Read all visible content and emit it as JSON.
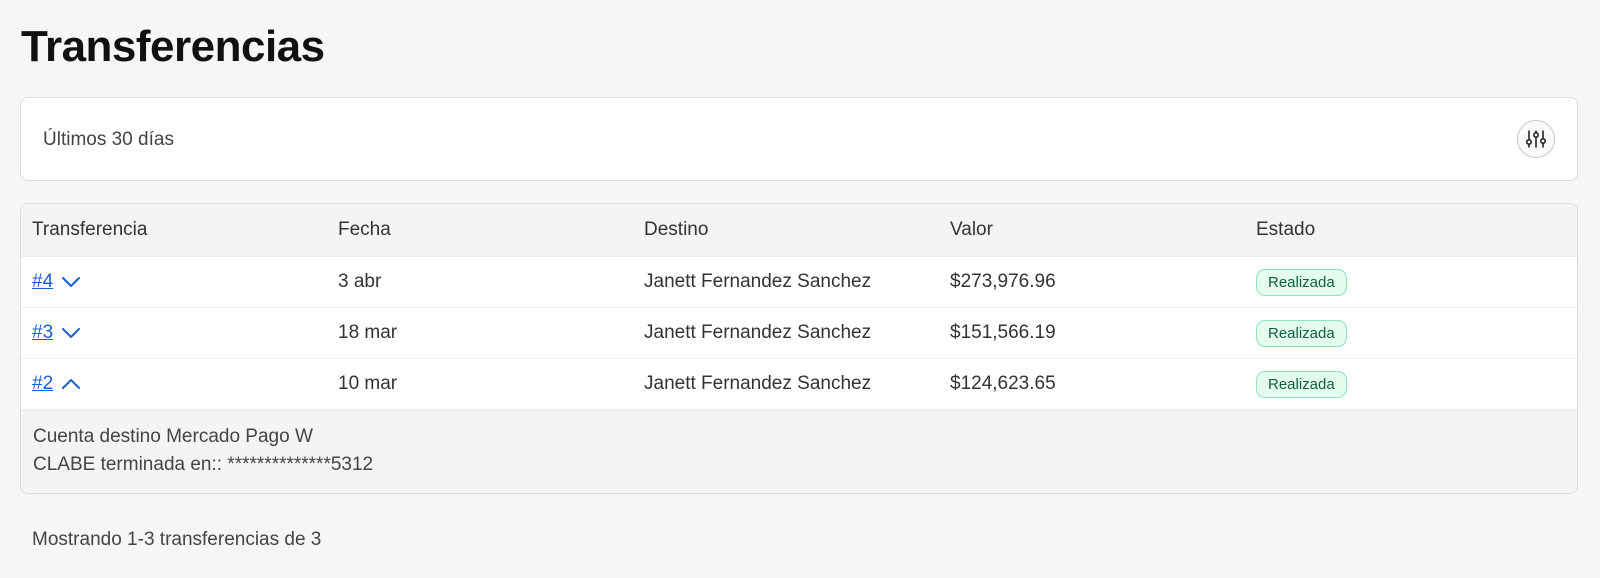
{
  "page": {
    "title": "Transferencias"
  },
  "filter": {
    "label": "Últimos 30 días",
    "button_icon": "sliders-icon"
  },
  "table": {
    "columns": [
      "Transferencia",
      "Fecha",
      "Destino",
      "Valor",
      "Estado"
    ],
    "rows": [
      {
        "id": "#4",
        "date": "3 abr",
        "destination": "Janett Fernandez Sanchez",
        "amount": "$273,976.96",
        "status": "Realizada",
        "expanded": false
      },
      {
        "id": "#3",
        "date": "18 mar",
        "destination": "Janett Fernandez Sanchez",
        "amount": "$151,566.19",
        "status": "Realizada",
        "expanded": false
      },
      {
        "id": "#2",
        "date": "10 mar",
        "destination": "Janett Fernandez Sanchez",
        "amount": "$124,623.65",
        "status": "Realizada",
        "expanded": true
      }
    ],
    "detail": {
      "line1": "Cuenta destino Mercado Pago W",
      "line2": "CLABE terminada en:: **************5312"
    }
  },
  "footer": {
    "summary": "Mostrando 1-3 transferencias de 3"
  },
  "colors": {
    "link": "#1a5fd0",
    "badge_text": "#12603c",
    "badge_bg": "#e4fbf0",
    "badge_border": "#8fe3bd"
  }
}
